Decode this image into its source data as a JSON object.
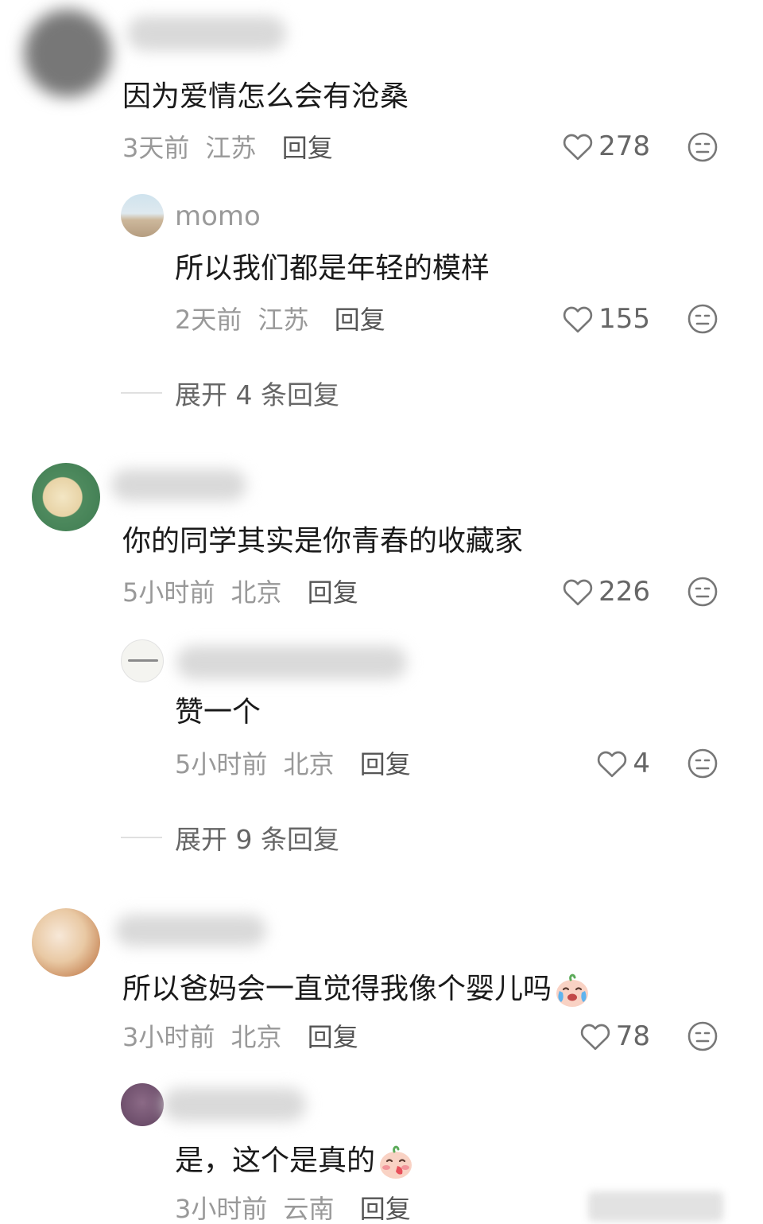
{
  "comments": [
    {
      "text": "因为爱情怎么会有沧桑",
      "time": "3天前",
      "location": "江苏",
      "reply_label": "回复",
      "likes": "278",
      "replies": [
        {
          "username": "momo",
          "text": "所以我们都是年轻的模样",
          "time": "2天前",
          "location": "江苏",
          "reply_label": "回复",
          "likes": "155"
        }
      ],
      "expand_label": "展开 4 条回复"
    },
    {
      "text": "你的同学其实是你青春的收藏家",
      "time": "5小时前",
      "location": "北京",
      "reply_label": "回复",
      "likes": "226",
      "replies": [
        {
          "text": "赞一个",
          "time": "5小时前",
          "location": "北京",
          "reply_label": "回复",
          "likes": "4"
        }
      ],
      "expand_label": "展开 9 条回复"
    },
    {
      "text": "所以爸妈会一直觉得我像个婴儿吗",
      "emoji": "crying-baby-emoji",
      "time": "3小时前",
      "location": "北京",
      "reply_label": "回复",
      "likes": "78",
      "replies": [
        {
          "text": "是，这个是真的",
          "emoji": "blushing-baby-emoji",
          "time": "3小时前",
          "location": "云南",
          "reply_label": "回复"
        }
      ]
    }
  ],
  "icons": {
    "like": "heart-outline-icon",
    "dislike": "neutral-face-icon"
  },
  "colors": {
    "text": "#1a1a1a",
    "meta": "#999999",
    "background": "#ffffff"
  }
}
